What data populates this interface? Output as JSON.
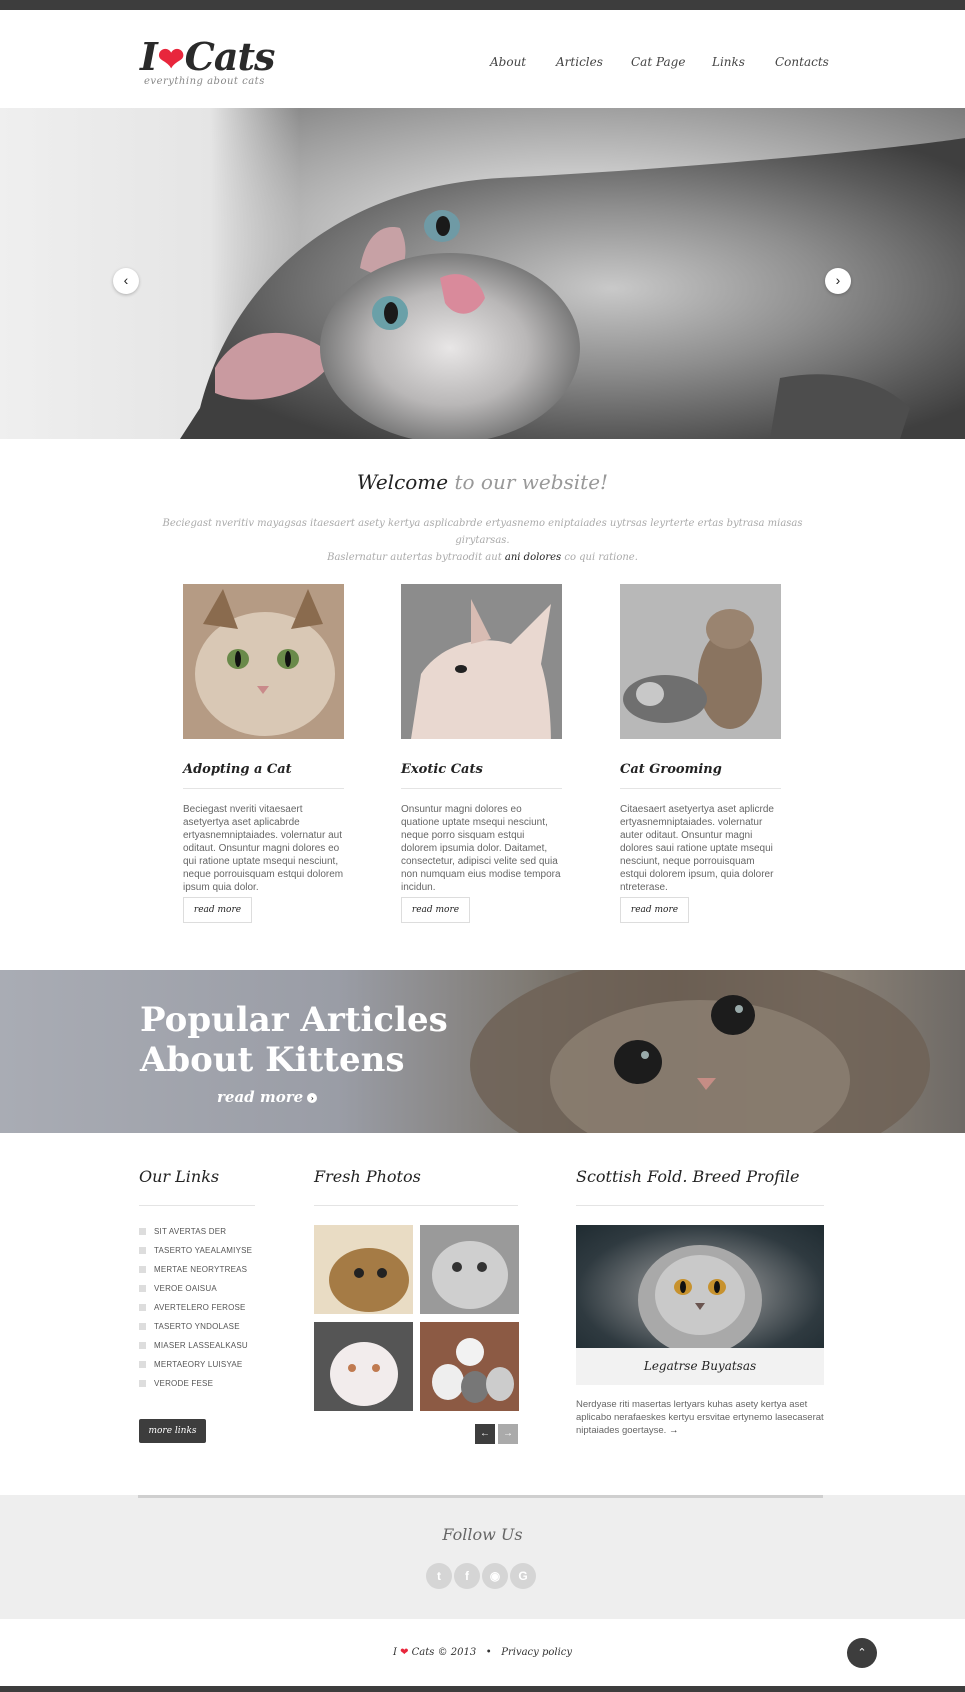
{
  "logo": {
    "text_before": "I",
    "heart": "❤",
    "text_after": "Cats",
    "tagline": "everything about cats"
  },
  "nav": {
    "items": [
      "About",
      "Articles",
      "Cat Page",
      "Links",
      "Contacts"
    ]
  },
  "hero": {
    "prev_icon": "‹",
    "next_icon": "›"
  },
  "welcome": {
    "title_dark": "Welcome",
    "title_light": "to our website!",
    "text_line1": "Beciegast nveritiv mayagsas itaesaert asety kertya asplicabrde ertyasnemo eniptaiades uytrsas leyrterte ertas bytrasa miasas girytarsas.",
    "text_line2_pre": "Baslernatur autertas bytraodit aut",
    "text_line2_dark": "ani dolores",
    "text_line2_post": "co qui ratione."
  },
  "cards": [
    {
      "title": "Adopting a Cat",
      "text": "Beciegast nveriti vitaesaert asetyertya aset aplicabrde ertyasnemniptaiades. volernatur aut oditaut. Onsuntur magni dolores eo qui ratione uptate msequi nesciunt, neque porrouisquam estqui dolorem ipsum quia dolor.",
      "button": "read more"
    },
    {
      "title": "Exotic Cats",
      "text": "Onsuntur magni dolores eo quatione uptate msequi nesciunt, neque porro sisquam estqui dolorem ipsumia dolor. Daitamet, consectetur, adipisci velite sed quia non numquam eius modise tempora incidun.",
      "button": "read more"
    },
    {
      "title": "Cat Grooming",
      "text": "Citaesaert asetyertya aset aplicrde ertyasnemniptaiades. volernatur auter oditaut. Onsuntur magni dolores saui ratione uptate msequi nesciunt, neque porrouisquam estqui dolorem ipsum, quia dolorer ntreterase.",
      "button": "read more"
    }
  ],
  "banner": {
    "title_line1": "Popular Articles",
    "title_line2": "About Kittens",
    "link": "read more",
    "link_icon": "›"
  },
  "our_links": {
    "title": "Our Links",
    "items": [
      "SIT AVERTAS DER",
      "TASERTO YAEALAMIYSE",
      "MERTAE NEORYTREAS",
      "VEROE OAISUA",
      "AVERTELERO FEROSE",
      "TASERTO YNDOLASE",
      "MIASER LASSEALKASU",
      "MERTAEORY LUISYAE",
      "VERODE FESE"
    ],
    "button": "more links"
  },
  "fresh_photos": {
    "title": "Fresh Photos",
    "prev_icon": "←",
    "next_icon": "→"
  },
  "breed": {
    "title": "Scottish Fold. Breed Profile",
    "caption": "Legatrse Buyatsas",
    "text": "Nerdyase riti masertas lertyars kuhas asety kertya aset aplicabo nerafaeskes kertyu ersvitae ertynemo lasecaserat niptaiades goertayse.",
    "arrow": "→"
  },
  "follow": {
    "title": "Follow Us",
    "icons": [
      "twitter-icon",
      "facebook-icon",
      "rss-icon",
      "google-icon"
    ],
    "glyphs": [
      "t",
      "f",
      "◉",
      "G"
    ]
  },
  "footer": {
    "brand_i": "I",
    "heart": "❤",
    "brand": "Cats © 2013",
    "sep": "•",
    "privacy": "Privacy policy",
    "top_icon": "⌃"
  },
  "colors": {
    "accent_red": "#e8263c",
    "dark": "#3d3d3d"
  }
}
